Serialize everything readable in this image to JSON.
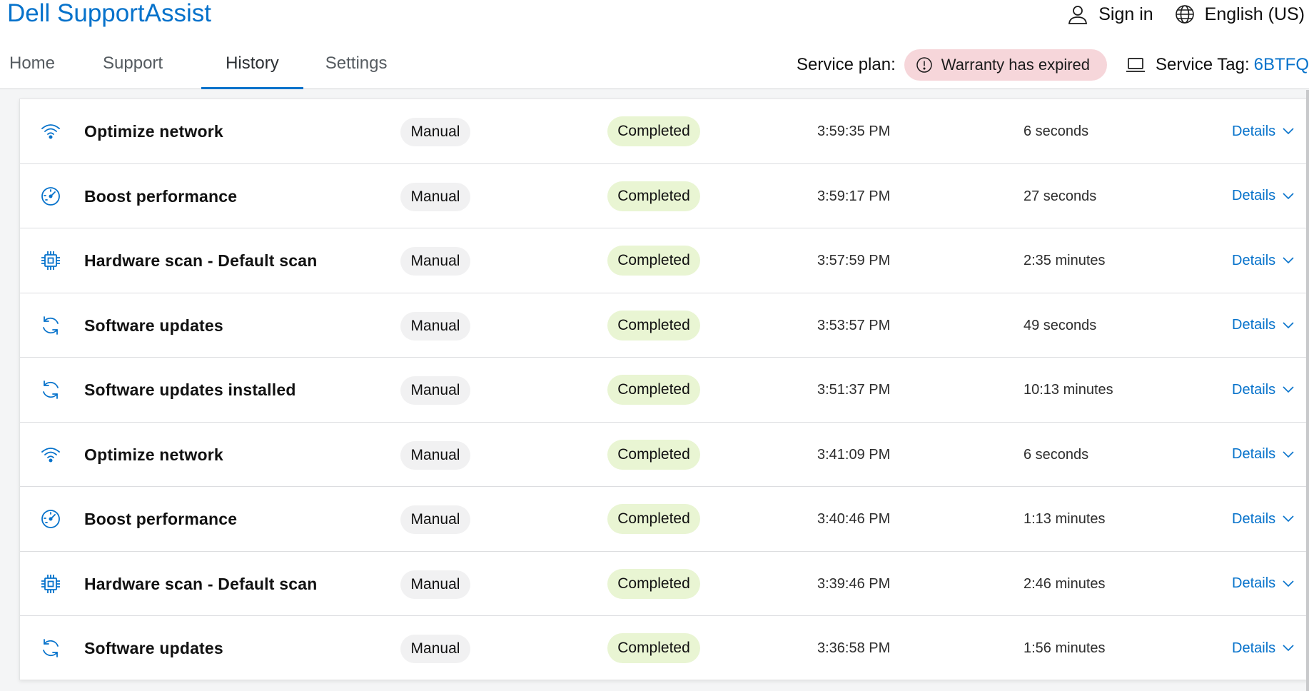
{
  "app": {
    "title": "Dell SupportAssist"
  },
  "header": {
    "sign_in": "Sign in",
    "language": "English (US)",
    "service_plan_label": "Service plan:",
    "warranty_status": "Warranty has expired",
    "service_tag_label": "Service Tag:",
    "service_tag_value": "6BTFQ"
  },
  "nav": {
    "tabs": [
      "Home",
      "Support",
      "History",
      "Settings"
    ],
    "active": "History"
  },
  "colors": {
    "accent": "#0672cb",
    "warranty_bg": "#f6d6da",
    "completed_bg": "#e9f5d3"
  },
  "history": {
    "rows": [
      {
        "icon": "wifi-icon",
        "name": "Optimize network",
        "type": "Manual",
        "status": "Completed",
        "time": "3:59:35 PM",
        "duration": "6 seconds",
        "details": "Details"
      },
      {
        "icon": "gauge-icon",
        "name": "Boost performance",
        "type": "Manual",
        "status": "Completed",
        "time": "3:59:17 PM",
        "duration": "27 seconds",
        "details": "Details"
      },
      {
        "icon": "chip-icon",
        "name": "Hardware scan - Default scan",
        "type": "Manual",
        "status": "Completed",
        "time": "3:57:59 PM",
        "duration": "2:35 minutes",
        "details": "Details"
      },
      {
        "icon": "refresh-icon",
        "name": "Software updates",
        "type": "Manual",
        "status": "Completed",
        "time": "3:53:57 PM",
        "duration": "49 seconds",
        "details": "Details"
      },
      {
        "icon": "refresh-icon",
        "name": "Software updates installed",
        "type": "Manual",
        "status": "Completed",
        "time": "3:51:37 PM",
        "duration": "10:13 minutes",
        "details": "Details"
      },
      {
        "icon": "wifi-icon",
        "name": "Optimize network",
        "type": "Manual",
        "status": "Completed",
        "time": "3:41:09 PM",
        "duration": "6 seconds",
        "details": "Details"
      },
      {
        "icon": "gauge-icon",
        "name": "Boost performance",
        "type": "Manual",
        "status": "Completed",
        "time": "3:40:46 PM",
        "duration": "1:13 minutes",
        "details": "Details"
      },
      {
        "icon": "chip-icon",
        "name": "Hardware scan - Default scan",
        "type": "Manual",
        "status": "Completed",
        "time": "3:39:46 PM",
        "duration": "2:46 minutes",
        "details": "Details"
      },
      {
        "icon": "refresh-icon",
        "name": "Software updates",
        "type": "Manual",
        "status": "Completed",
        "time": "3:36:58 PM",
        "duration": "1:56 minutes",
        "details": "Details"
      }
    ]
  }
}
